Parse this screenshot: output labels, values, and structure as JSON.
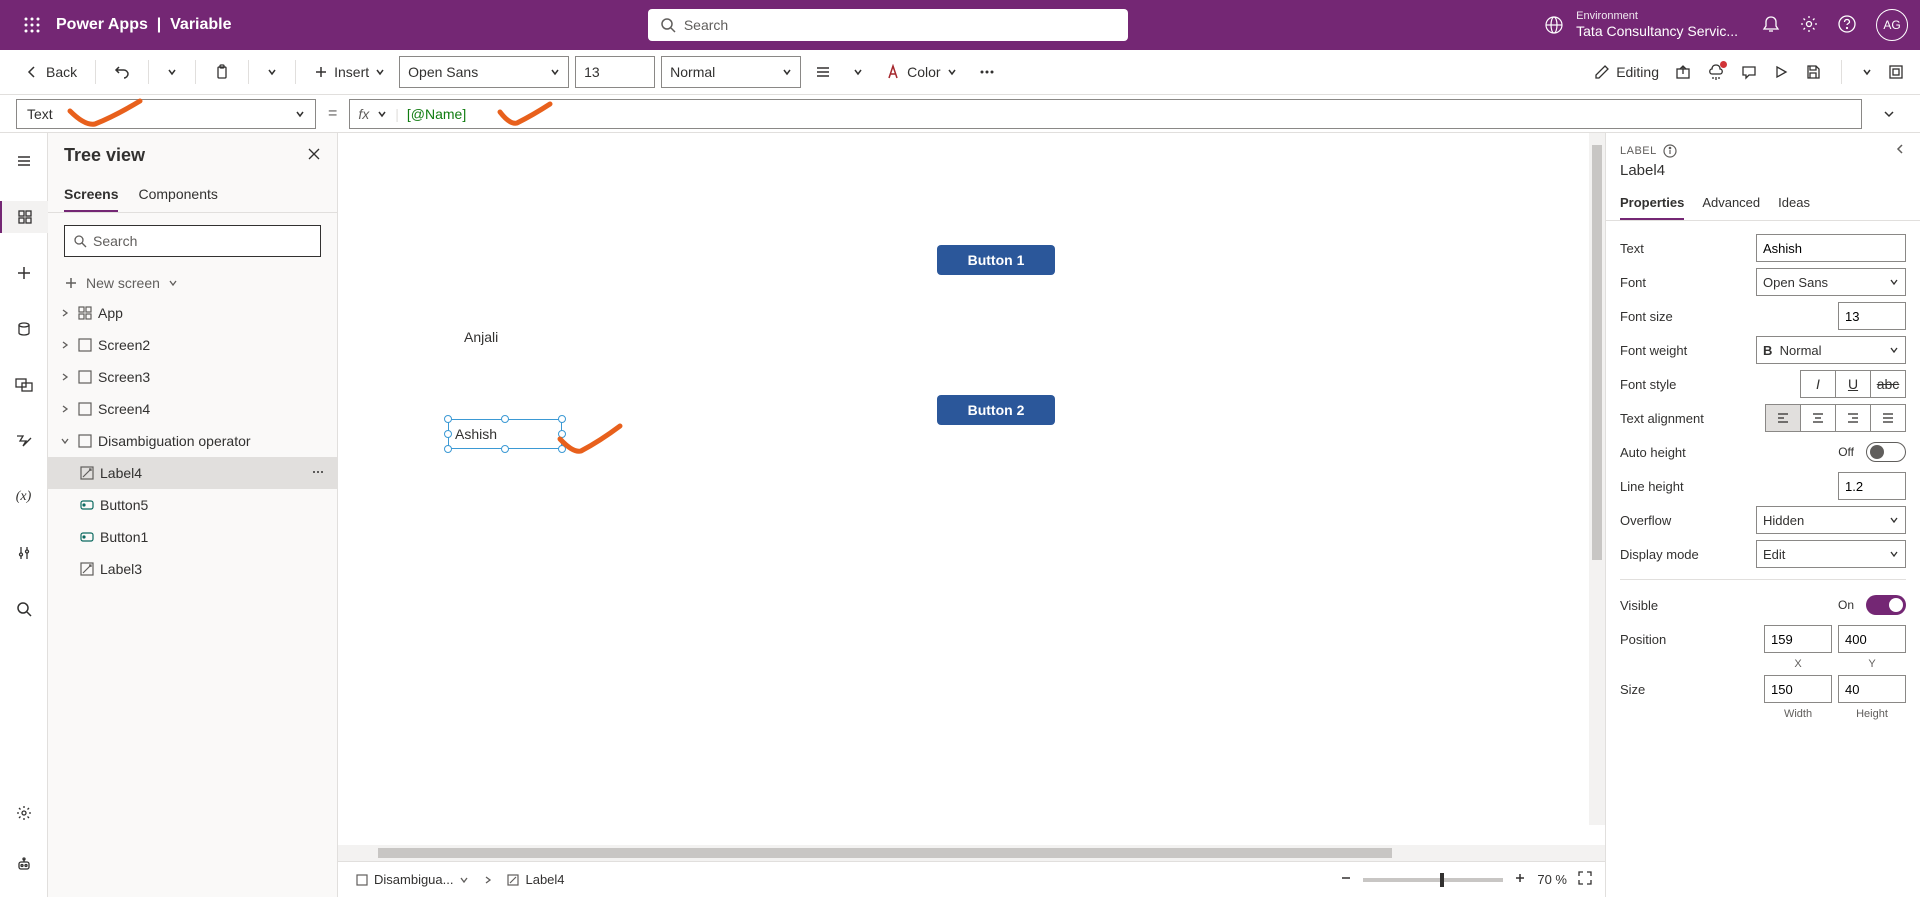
{
  "topbar": {
    "app_name": "Power Apps",
    "page_name": "Variable",
    "search_placeholder": "Search",
    "env_label": "Environment",
    "env_name": "Tata Consultancy Servic...",
    "avatar_initials": "AG"
  },
  "cmdbar": {
    "back": "Back",
    "insert": "Insert",
    "font": "Open Sans",
    "font_size": "13",
    "font_weight": "Normal",
    "color": "Color",
    "editing": "Editing"
  },
  "formulabar": {
    "property": "Text",
    "fx": "fx",
    "formula": "[@Name]"
  },
  "treeview": {
    "title": "Tree view",
    "tab_screens": "Screens",
    "tab_components": "Components",
    "search_placeholder": "Search",
    "new_screen": "New screen",
    "items": {
      "app": "App",
      "screen2": "Screen2",
      "screen3": "Screen3",
      "screen4": "Screen4",
      "disamb": "Disambiguation operator",
      "label4": "Label4",
      "button5": "Button5",
      "button1": "Button1",
      "label3": "Label3"
    }
  },
  "canvas": {
    "anjali": "Anjali",
    "ashish": "Ashish",
    "button1": "Button 1",
    "button2": "Button 2",
    "breadcrumb_screen": "Disambigua...",
    "breadcrumb_control": "Label4",
    "zoom": "70  %"
  },
  "props": {
    "type": "LABEL",
    "name": "Label4",
    "tab_properties": "Properties",
    "tab_advanced": "Advanced",
    "tab_ideas": "Ideas",
    "text_label": "Text",
    "text_value": "Ashish",
    "font_label": "Font",
    "font_value": "Open Sans",
    "fontsize_label": "Font size",
    "fontsize_value": "13",
    "fontweight_label": "Font weight",
    "fontweight_value": "Normal",
    "fontstyle_label": "Font style",
    "textalign_label": "Text alignment",
    "autoheight_label": "Auto height",
    "autoheight_value": "Off",
    "lineheight_label": "Line height",
    "lineheight_value": "1.2",
    "overflow_label": "Overflow",
    "overflow_value": "Hidden",
    "displaymode_label": "Display mode",
    "displaymode_value": "Edit",
    "visible_label": "Visible",
    "visible_value": "On",
    "position_label": "Position",
    "position_x": "159",
    "position_y": "400",
    "pos_x_label": "X",
    "pos_y_label": "Y",
    "size_label": "Size",
    "size_w": "150",
    "size_h": "40",
    "size_w_label": "Width",
    "size_h_label": "Height",
    "bold_prefix": "B"
  }
}
